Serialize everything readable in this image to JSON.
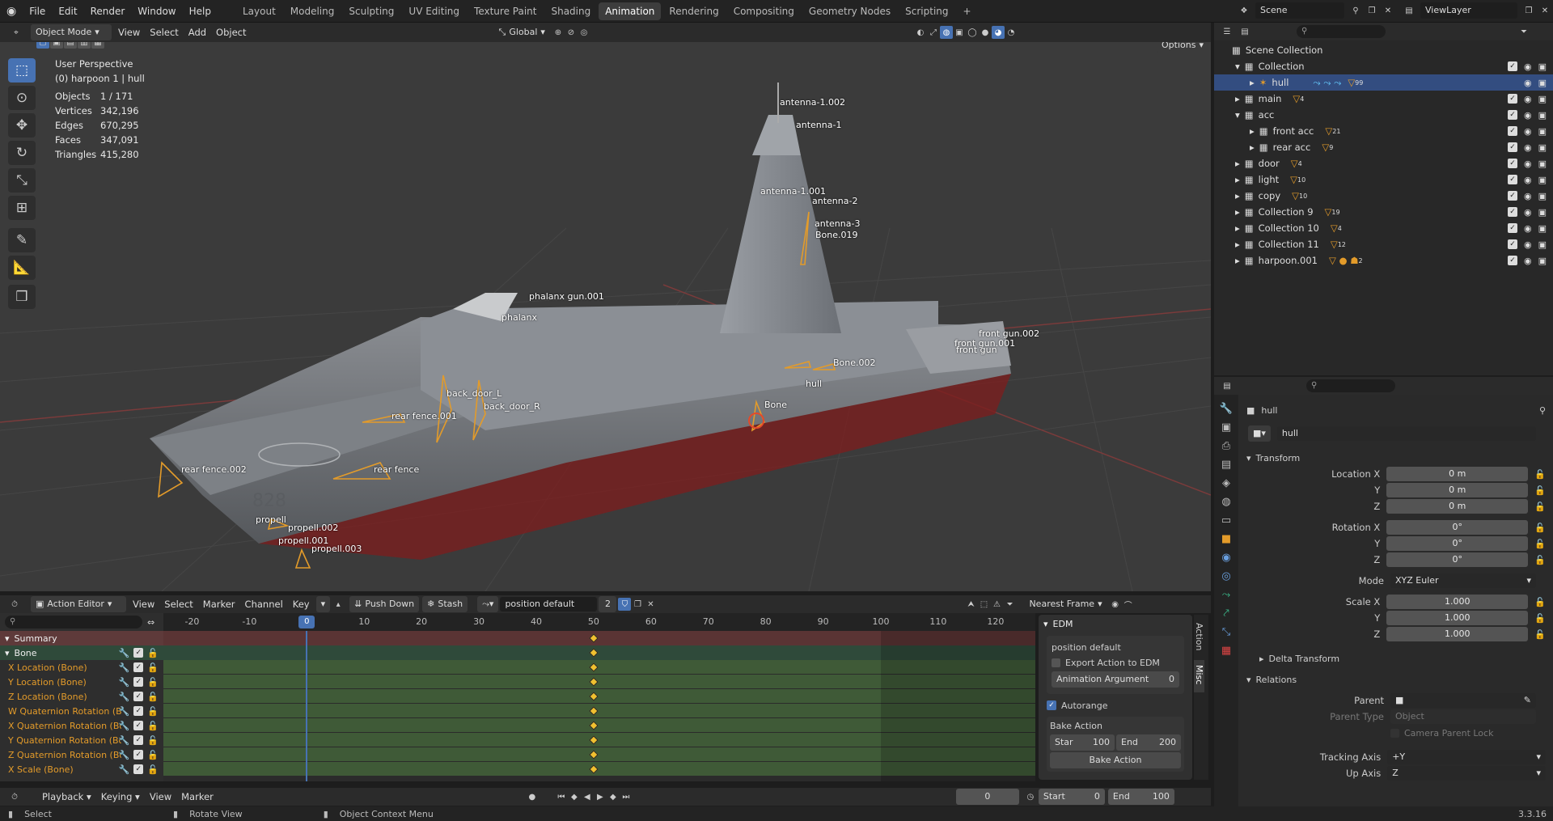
{
  "topmenu": {
    "items": [
      "File",
      "Edit",
      "Render",
      "Window",
      "Help"
    ],
    "workspaces": [
      "Layout",
      "Modeling",
      "Sculpting",
      "UV Editing",
      "Texture Paint",
      "Shading",
      "Animation",
      "Rendering",
      "Compositing",
      "Geometry Nodes",
      "Scripting"
    ],
    "active_workspace": "Animation",
    "add_tab": "+",
    "scene": "Scene",
    "view_layer": "ViewLayer"
  },
  "viewport_header": {
    "mode": "Object Mode",
    "menus": [
      "View",
      "Select",
      "Add",
      "Object"
    ],
    "orientation": "Global",
    "options": "Options"
  },
  "viewport": {
    "perspective": "User Perspective",
    "context": "(0) harpoon 1 | hull",
    "stats": [
      {
        "label": "Objects",
        "value": "1 / 171"
      },
      {
        "label": "Vertices",
        "value": "342,196"
      },
      {
        "label": "Edges",
        "value": "670,295"
      },
      {
        "label": "Faces",
        "value": "347,091"
      },
      {
        "label": "Triangles",
        "value": "415,280"
      }
    ],
    "hull_number": "828",
    "labels": [
      "antenna-1.002",
      "antenna-1",
      "antenna-1.001",
      "antenna-2",
      "antenna-3",
      "Bone.019",
      "phalanx gun.001",
      "phalanx",
      "back_door_L",
      "back_door_R",
      "rear fence.001",
      "rear fence.002",
      "rear fence",
      "Bone",
      "hull",
      "Bone.002",
      "front gun.002",
      "front gun.001",
      "front gun",
      "propell",
      "propell.002",
      "propell.001",
      "propell.003"
    ]
  },
  "outliner": {
    "root": "Scene Collection",
    "rows": [
      {
        "name": "Collection",
        "badge": ""
      },
      {
        "name": "hull",
        "badge": "99"
      },
      {
        "name": "main",
        "badge": "4"
      },
      {
        "name": "acc",
        "badge": ""
      },
      {
        "name": "front acc",
        "badge": "21"
      },
      {
        "name": "rear acc",
        "badge": "9"
      },
      {
        "name": "door",
        "badge": "4"
      },
      {
        "name": "light",
        "badge": "10"
      },
      {
        "name": "copy",
        "badge": "10"
      },
      {
        "name": "Collection 9",
        "badge": "19"
      },
      {
        "name": "Collection 10",
        "badge": "4"
      },
      {
        "name": "Collection 11",
        "badge": "12"
      },
      {
        "name": "harpoon.001",
        "badge": "2"
      }
    ]
  },
  "properties": {
    "object_name": "hull",
    "data_name": "hull",
    "transform_title": "Transform",
    "location_label": "Location X",
    "location": [
      "0 m",
      "0 m",
      "0 m"
    ],
    "rotation_label": "Rotation X",
    "rotation": [
      "0°",
      "0°",
      "0°"
    ],
    "mode_label": "Mode",
    "mode": "XYZ Euler",
    "scale_label": "Scale X",
    "scale": [
      "1.000",
      "1.000",
      "1.000"
    ],
    "y_label": "Y",
    "z_label": "Z",
    "delta_title": "Delta Transform",
    "relations_title": "Relations",
    "parent_label": "Parent",
    "parent_type_label": "Parent Type",
    "parent_type": "Object",
    "camera_parent_lock": "Camera Parent Lock",
    "tracking_axis_label": "Tracking Axis",
    "tracking_axis": "+Y",
    "up_axis_label": "Up Axis",
    "up_axis": "Z"
  },
  "action_editor": {
    "editor": "Action Editor",
    "menus": [
      "View",
      "Select",
      "Marker",
      "Channel",
      "Key"
    ],
    "push_down": "Push Down",
    "stash": "Stash",
    "action_name": "position default",
    "users": "2",
    "snap": "Nearest Frame",
    "ruler": [
      "-20",
      "-10",
      "0",
      "10",
      "20",
      "30",
      "40",
      "50",
      "60",
      "70",
      "80",
      "90",
      "100",
      "110",
      "120"
    ],
    "current_frame": 0,
    "keyframe_frame": 50,
    "frame_min": -25,
    "frame_max": 127,
    "summary": "Summary",
    "group": "Bone",
    "channels": [
      "X Location (Bone)",
      "Y Location (Bone)",
      "Z Location (Bone)",
      "W Quaternion Rotation (Bone)",
      "X Quaternion Rotation (Bone)",
      "Y Quaternion Rotation (Bone)",
      "Z Quaternion Rotation (Bone)",
      "X Scale (Bone)"
    ]
  },
  "edm_panel": {
    "title": "EDM",
    "action_name": "position default",
    "export_label": "Export Action to EDM",
    "anim_arg_label": "Animation Argument",
    "anim_arg_value": "0",
    "autorange": "Autorange",
    "bake_title": "Bake Action",
    "start_label": "Star",
    "start_value": "100",
    "end_label": "End",
    "end_value": "200",
    "bake_button": "Bake Action",
    "side_tabs": [
      "Action",
      "Misc"
    ]
  },
  "timeline": {
    "menus": [
      "Playback",
      "Keying",
      "View",
      "Marker"
    ],
    "current_frame": "0",
    "start_label": "Start",
    "start": "0",
    "end_label": "End",
    "end": "100"
  },
  "statusbar": {
    "select": "Select",
    "rotate": "Rotate View",
    "context_menu": "Object Context Menu",
    "version": "3.3.16"
  },
  "colors": {
    "accent": "#4772b3",
    "orange": "#e39b2a",
    "keyframe": "#f0c030",
    "channel_bg": "#3f5a37"
  }
}
